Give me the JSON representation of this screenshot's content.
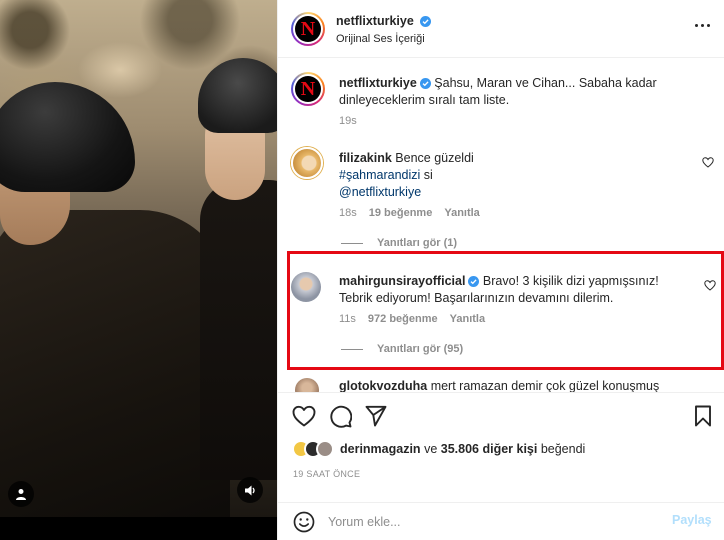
{
  "post": {
    "username": "netflixturkiye",
    "audio": "Orijinal Ses İçeriği",
    "icons": {
      "more": "more-horizontal-icon",
      "verified": "verified-badge-icon"
    }
  },
  "caption": {
    "username": "netflixturkiye",
    "text": "Şahsu, Maran ve Cihan... Sabaha kadar dinleyeceklerim sıralı tam liste.",
    "time": "19s"
  },
  "comments": [
    {
      "username": "filizakink",
      "text_before": "Bence güzeldi",
      "hashtag": "#şahmarandizi",
      "text_after": " si",
      "mention": "@netflixturkiye",
      "time": "18s",
      "likes": "19 beğenme",
      "reply": "Yanıtla",
      "view_replies": "Yanıtları gör (1)"
    },
    {
      "username": "mahirgunsirayofficial",
      "text": "Bravo! 3 kişilik dizi yapmışsınız! Tebrik ediyorum! Başarılarınızın devamını dilerim.",
      "time": "11s",
      "likes": "972 beğenme",
      "reply": "Yanıtla",
      "view_replies": "Yanıtları gör (95)"
    },
    {
      "username": "glotokvozduha",
      "text": "mert ramazan demir çok güzel konuşmuş"
    }
  ],
  "likes": {
    "liker": "derinmagazin",
    "connector": "ve",
    "others": "35.806 diğer kişi",
    "suffix": "beğendi"
  },
  "time_ago": "19 SAAT ÖNCE",
  "add_comment": {
    "placeholder": "Yorum ekle...",
    "post_label": "Paylaş"
  },
  "colors": {
    "highlight": "#e50914",
    "netflix_red": "#e50914",
    "verified": "#3897f0",
    "post_disabled": "#b2dffc"
  }
}
